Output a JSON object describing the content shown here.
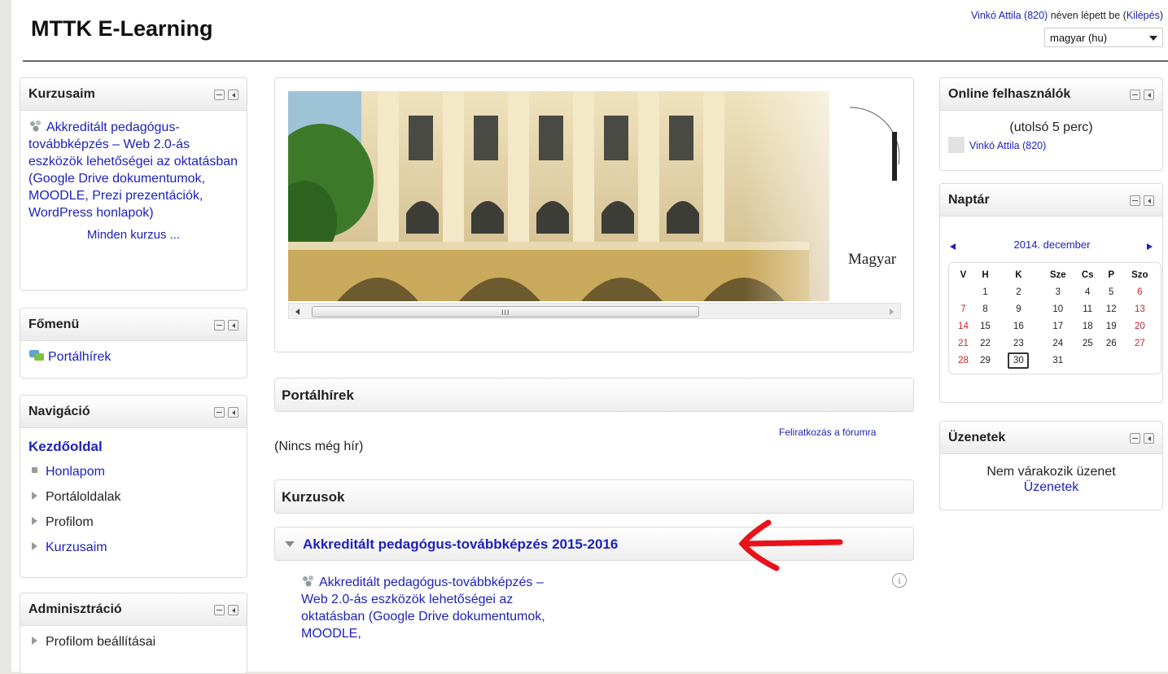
{
  "header": {
    "site_title": "MTTK E-Learning",
    "user_name": "Vinkó Attila (820)",
    "logged_in_text": " néven lépett be (",
    "logout_label": "Kilépés",
    "logout_close": ")",
    "language": "magyar (hu)"
  },
  "left": {
    "kurzusaim": {
      "title": "Kurzusaim",
      "course": "Akkreditált pedagógus-továbbképzés – Web 2.0-ás eszközök lehetőségei az oktatásban (Google Drive dokumentumok, MOODLE, Prezi prezentációk, WordPress honlapok)",
      "all_courses": "Minden kurzus ..."
    },
    "fomenu": {
      "title": "Főmenü",
      "item": "Portálhírek"
    },
    "navigacio": {
      "title": "Navigáció",
      "home": "Kezdőoldal",
      "items": [
        "Honlapom",
        "Portáloldalak",
        "Profilom",
        "Kurzusaim"
      ]
    },
    "adminisztracio": {
      "title": "Adminisztráció",
      "items": [
        "Profilom beállításai"
      ]
    }
  },
  "center": {
    "banner_text": "Magyar",
    "news_title": "Portálhírek",
    "subscribe_label": "Feliratkozás a fórumra",
    "no_news": "(Nincs még hír)",
    "courses_title": "Kurzusok",
    "category": "Akkreditált pedagógus-továbbképzés 2015-2016",
    "course_listing": "Akkreditált pedagógus-továbbképzés – Web 2.0-ás eszközök lehetőségei az oktatásban (Google Drive dokumentumok, MOODLE,"
  },
  "right": {
    "online": {
      "title": "Online felhasználók",
      "period": "(utolsó 5 perc)",
      "user": "Vinkó Attila (820)"
    },
    "calendar": {
      "title": "Naptár",
      "month": "2014. december",
      "weekdays": [
        "V",
        "H",
        "K",
        "Sze",
        "Cs",
        "P",
        "Szo"
      ],
      "weeks": [
        [
          "",
          "1",
          "2",
          "3",
          "4",
          "5",
          "6"
        ],
        [
          "7",
          "8",
          "9",
          "10",
          "11",
          "12",
          "13"
        ],
        [
          "14",
          "15",
          "16",
          "17",
          "18",
          "19",
          "20"
        ],
        [
          "21",
          "22",
          "23",
          "24",
          "25",
          "26",
          "27"
        ],
        [
          "28",
          "29",
          "30",
          "31",
          "",
          "",
          ""
        ]
      ],
      "today": "30"
    },
    "messages": {
      "title": "Üzenetek",
      "status": "Nem várakozik üzenet",
      "link": "Üzenetek"
    }
  },
  "colors": {
    "link": "#1e22b8",
    "annotation_arrow": "#e8121a",
    "weekend": "#c0262b"
  }
}
